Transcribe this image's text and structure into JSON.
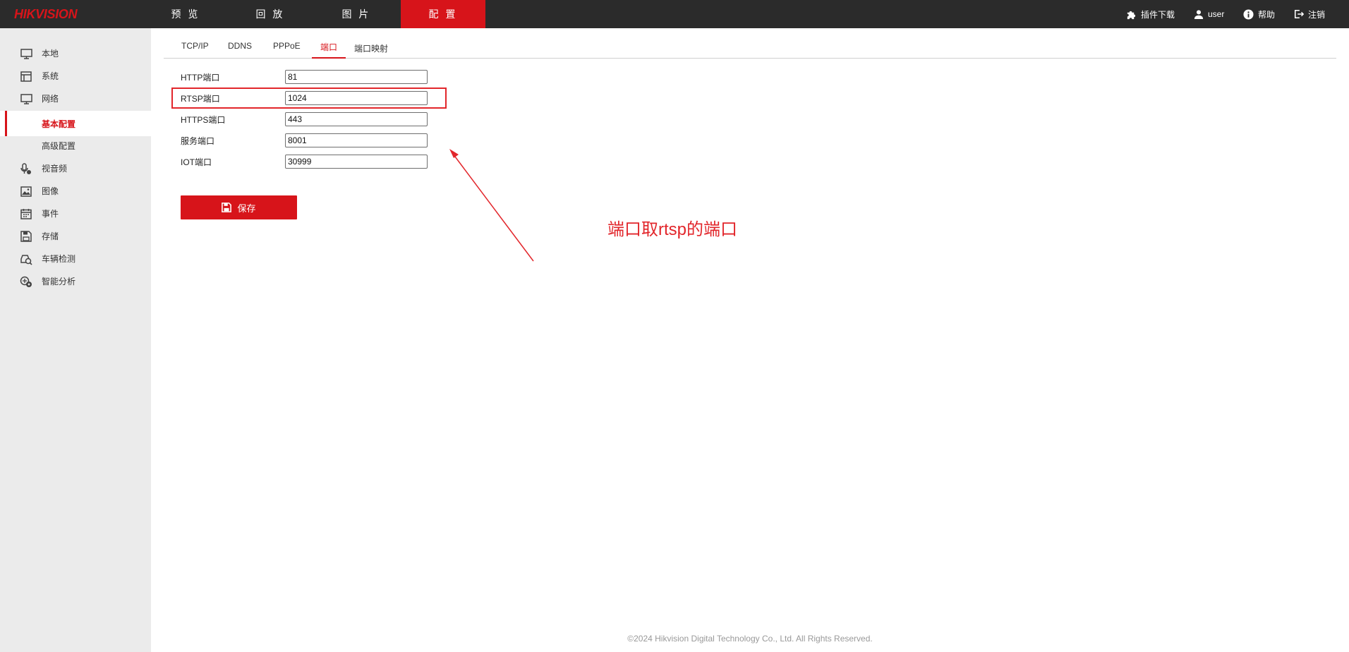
{
  "brand": {
    "logo_text": "HIKVISION",
    "accent": "#d7141a"
  },
  "topnav": {
    "items": [
      {
        "label": "预 览"
      },
      {
        "label": "回 放"
      },
      {
        "label": "图 片"
      },
      {
        "label": "配 置",
        "active": true
      }
    ],
    "right": {
      "plugin_label": "插件下载",
      "user_label": "user",
      "help_label": "帮助",
      "logout_label": "注销"
    }
  },
  "sidebar": {
    "items": [
      {
        "label": "本地",
        "icon": "monitor-icon"
      },
      {
        "label": "系统",
        "icon": "system-icon"
      },
      {
        "label": "网络",
        "icon": "network-icon"
      },
      {
        "label": "基本配置",
        "sub": true,
        "selected": true
      },
      {
        "label": "高级配置",
        "sub": true
      },
      {
        "label": "视音频",
        "icon": "microphone-icon"
      },
      {
        "label": "图像",
        "icon": "image-icon"
      },
      {
        "label": "事件",
        "icon": "calendar-icon"
      },
      {
        "label": "存储",
        "icon": "storage-icon"
      },
      {
        "label": "车辆检测",
        "icon": "vehicle-detect-icon"
      },
      {
        "label": "智能分析",
        "icon": "smart-analysis-icon"
      }
    ]
  },
  "tabs": [
    {
      "label": "TCP/IP"
    },
    {
      "label": "DDNS"
    },
    {
      "label": "PPPoE"
    },
    {
      "label": "端口",
      "active": true
    },
    {
      "label": "端口映射"
    }
  ],
  "form": {
    "fields": [
      {
        "label": "HTTP端口",
        "value": "81"
      },
      {
        "label": "RTSP端口",
        "value": "1024"
      },
      {
        "label": "HTTPS端口",
        "value": "443"
      },
      {
        "label": "服务端口",
        "value": "8001"
      },
      {
        "label": "IOT端口",
        "value": "30999"
      }
    ],
    "save_label": "保存"
  },
  "annotation": {
    "text": "端口取rtsp的端口",
    "color": "#e2262b"
  },
  "footer": {
    "copyright": "©2024 Hikvision Digital Technology Co., Ltd. All Rights Reserved."
  }
}
